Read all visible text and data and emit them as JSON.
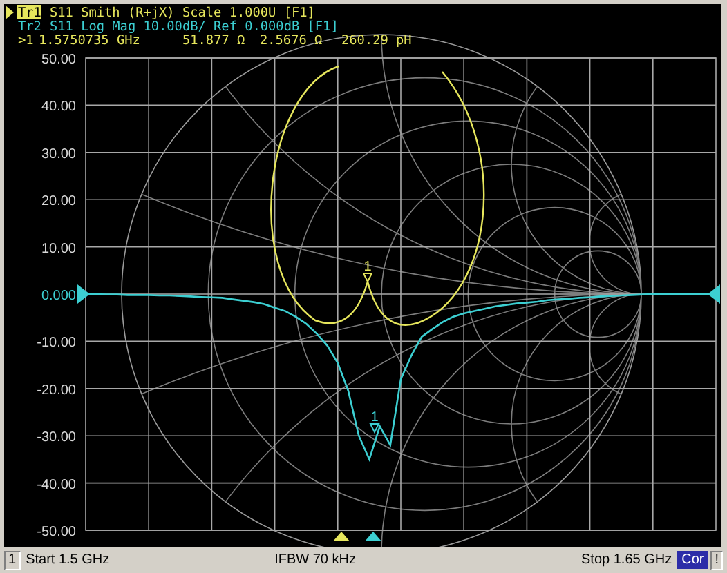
{
  "traces": [
    {
      "label": "Tr1",
      "selected": true,
      "description": "S11 Smith (R+jX) Scale 1.000U [F1]",
      "color": "#e6e65c"
    },
    {
      "label": "Tr2",
      "selected": false,
      "description": "S11 Log Mag 10.00dB/ Ref 0.000dB [F1]",
      "color": "#3ccfd2"
    }
  ],
  "marker_readout": {
    "marker": ">1",
    "frequency": "1.5750735 GHz",
    "resistance": "51.877 Ω",
    "reactance": "2.5676 Ω",
    "inductance": "260.29 pH"
  },
  "marker_labels": [
    {
      "text": "1",
      "color": "#e6e65c"
    },
    {
      "text": "1",
      "color": "#3ccfd2"
    }
  ],
  "chart_data": {
    "type": "line",
    "grid": true,
    "ylim": [
      -50,
      50
    ],
    "yticks": [
      {
        "value": 50,
        "label": "50.00"
      },
      {
        "value": 40,
        "label": "40.00"
      },
      {
        "value": 30,
        "label": "30.00"
      },
      {
        "value": 20,
        "label": "20.00"
      },
      {
        "value": 10,
        "label": "10.00"
      },
      {
        "value": 0,
        "label": "0.000"
      },
      {
        "value": -10,
        "label": "-10.00"
      },
      {
        "value": -20,
        "label": "-20.00"
      },
      {
        "value": -30,
        "label": "-30.00"
      },
      {
        "value": -40,
        "label": "-40.00"
      },
      {
        "value": -50,
        "label": "-50.00"
      }
    ],
    "categories": [
      null,
      null,
      null,
      null,
      null,
      null,
      null,
      null,
      null,
      null,
      null,
      null,
      null,
      null,
      null,
      null,
      null,
      null,
      null,
      null,
      null,
      null,
      null,
      null,
      null,
      null,
      null,
      null,
      null,
      null,
      null,
      null,
      null,
      null,
      null,
      null,
      null,
      null,
      null,
      null,
      null,
      null,
      null,
      null,
      null,
      null,
      null,
      null,
      null,
      null,
      null,
      null,
      null,
      null,
      null,
      null,
      null,
      null,
      null,
      null,
      null
    ],
    "series": [
      {
        "color": "#3ccfd2",
        "values": [
          0,
          0,
          -0.1,
          -0.1,
          -0.2,
          -0.2,
          -0.2,
          -0.3,
          -0.3,
          -0.4,
          -0.5,
          -0.6,
          -0.7,
          -0.8,
          -1.1,
          -1.4,
          -1.7,
          -2.1,
          -2.9,
          -3.6,
          -4.8,
          -6.3,
          -8.4,
          -10.9,
          -14.6,
          -20.5,
          -30,
          -35,
          -28,
          -32,
          -18,
          -13,
          -9,
          -7.4,
          -5.9,
          -4.8,
          -4.1,
          -3.6,
          -3.1,
          -2.6,
          -2.3,
          -2,
          -1.8,
          -1.6,
          -1.3,
          -1.1,
          -1,
          -0.8,
          -0.7,
          -0.5,
          -0.4,
          -0.3,
          -0.2,
          -0.1,
          0,
          0,
          0,
          0,
          0,
          0,
          0
        ]
      }
    ]
  },
  "status_bar": {
    "channel": "1",
    "start": "Start 1.5 GHz",
    "ifbw": "IFBW 70 kHz",
    "stop": "Stop 1.65 GHz",
    "correction": "Cor",
    "warning": "!"
  }
}
